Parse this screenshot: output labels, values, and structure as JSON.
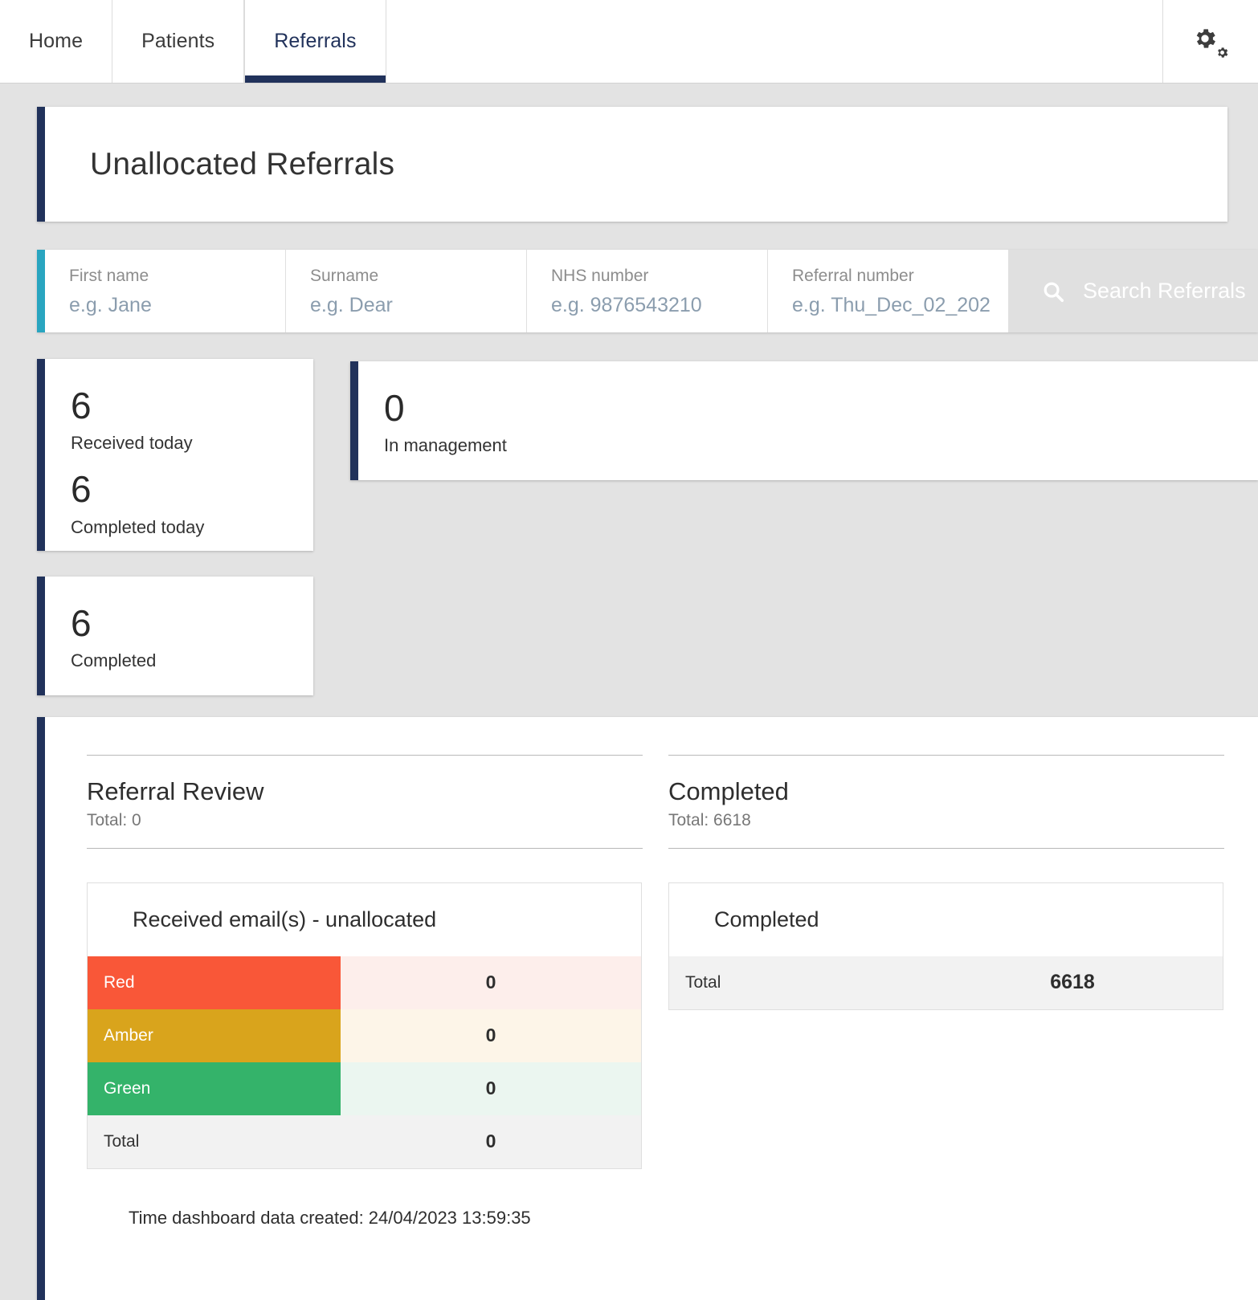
{
  "nav": {
    "tabs": [
      {
        "label": "Home",
        "active": false
      },
      {
        "label": "Patients",
        "active": false
      },
      {
        "label": "Referrals",
        "active": true
      }
    ],
    "settings_icon": "cogs-icon"
  },
  "header": {
    "title": "Unallocated Referrals"
  },
  "filters": {
    "accent_color": "#29a5c0",
    "fields": [
      {
        "label": "First name",
        "placeholder": "e.g. Jane",
        "value": ""
      },
      {
        "label": "Surname",
        "placeholder": "e.g. Dear",
        "value": ""
      },
      {
        "label": "NHS number",
        "placeholder": "e.g. 9876543210",
        "value": ""
      },
      {
        "label": "Referral number",
        "placeholder": "e.g. Thu_Dec_02_202",
        "value": ""
      }
    ],
    "search_button": {
      "label": "Search Referrals",
      "icon": "search-icon"
    }
  },
  "stats": {
    "accent_color": "#21325b",
    "today_card": [
      {
        "value": "6",
        "label": "Received today"
      },
      {
        "value": "6",
        "label": "Completed today"
      }
    ],
    "management_card": {
      "value": "0",
      "label": "In management"
    },
    "completed_card": {
      "value": "6",
      "label": "Completed"
    }
  },
  "dashboard": {
    "sections": [
      {
        "title": "Referral Review",
        "total_label": "Total: 0"
      },
      {
        "title": "Completed",
        "total_label": "Total: 6618"
      }
    ],
    "rag_table": {
      "caption": "Received email(s) - unallocated",
      "rows": [
        {
          "label": "Red",
          "value": "0",
          "bg": "#f95738",
          "value_bg": "#fdeeeb",
          "text": "#ffffff"
        },
        {
          "label": "Amber",
          "value": "0",
          "bg": "#d9a41c",
          "value_bg": "#fdf5e8",
          "text": "#ffffff"
        },
        {
          "label": "Green",
          "value": "0",
          "bg": "#34b36a",
          "value_bg": "#ebf6f0",
          "text": "#ffffff"
        },
        {
          "label": "Total",
          "value": "0",
          "bg": "#f2f2f2",
          "value_bg": "#f2f2f2",
          "text": "#333333"
        }
      ]
    },
    "completed_table": {
      "caption": "Completed",
      "row": {
        "label": "Total",
        "value": "6618"
      }
    },
    "timestamp": "Time dashboard data created: 24/04/2023 13:59:35"
  }
}
